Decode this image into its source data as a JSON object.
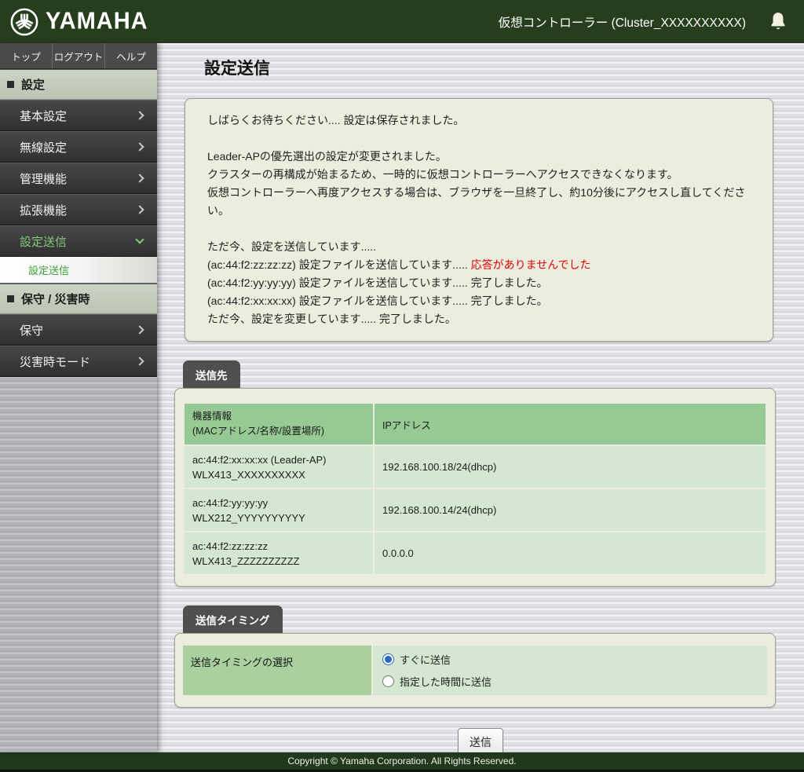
{
  "header": {
    "brand": "YAMAHA",
    "title": "仮想コントローラー (Cluster_XXXXXXXXXX)"
  },
  "nav_tabs": [
    {
      "label": "トップ"
    },
    {
      "label": "ログアウト"
    },
    {
      "label": "ヘルプ"
    }
  ],
  "sidebar": {
    "sections": [
      {
        "heading": "設定",
        "items": [
          {
            "label": "基本設定"
          },
          {
            "label": "無線設定"
          },
          {
            "label": "管理機能"
          },
          {
            "label": "拡張機能"
          },
          {
            "label": "設定送信",
            "expanded": true,
            "children": [
              {
                "label": "設定送信",
                "selected": true
              }
            ]
          }
        ]
      },
      {
        "heading": "保守 / 災害時",
        "items": [
          {
            "label": "保守"
          },
          {
            "label": "災害時モード"
          }
        ]
      }
    ]
  },
  "main": {
    "page_title": "設定送信",
    "message_box": {
      "lines": [
        {
          "text": "しばらくお待ちください.... 設定は保存されました。"
        },
        {
          "text": ""
        },
        {
          "text": "Leader-APの優先選出の設定が変更されました。"
        },
        {
          "text": "クラスターの再構成が始まるため、一時的に仮想コントローラーへアクセスできなくなります。"
        },
        {
          "text": "仮想コントローラーへ再度アクセスする場合は、ブラウザを一旦終了し、約10分後にアクセスし直してください。"
        },
        {
          "text": ""
        },
        {
          "text": "ただ今、設定を送信しています....."
        },
        {
          "text": "(ac:44:f2:zz:zz:zz) 設定ファイルを送信しています..... ",
          "red": "応答がありませんでした"
        },
        {
          "text": "(ac:44:f2:yy:yy:yy) 設定ファイルを送信しています..... 完了しました。"
        },
        {
          "text": "(ac:44:f2:xx:xx:xx) 設定ファイルを送信しています..... 完了しました。"
        },
        {
          "text": "ただ今、設定を変更しています..... 完了しました。"
        }
      ]
    },
    "destination": {
      "tab_label": "送信先",
      "table": {
        "col1_header_lines": [
          "機器情報",
          "(MACアドレス/名称/設置場所)"
        ],
        "col2_header": "IPアドレス",
        "rows": [
          {
            "device_lines": [
              "ac:44:f2:xx:xx:xx (Leader-AP)",
              "WLX413_XXXXXXXXXX"
            ],
            "ip": "192.168.100.18/24(dhcp)"
          },
          {
            "device_lines": [
              "ac:44:f2:yy:yy:yy",
              "WLX212_YYYYYYYYYY"
            ],
            "ip": "192.168.100.14/24(dhcp)"
          },
          {
            "device_lines": [
              "ac:44:f2:zz:zz:zz",
              "WLX413_ZZZZZZZZZZ"
            ],
            "ip": "0.0.0.0"
          }
        ]
      }
    },
    "timing": {
      "tab_label": "送信タイミング",
      "row_label": "送信タイミングの選択",
      "options": [
        {
          "label": "すぐに送信",
          "selected": true
        },
        {
          "label": "指定した時間に送信",
          "selected": false
        }
      ]
    },
    "submit_label": "送信"
  },
  "footer": {
    "copyright": "Copyright © Yamaha Corporation. All Rights Reserved."
  },
  "colors": {
    "header_green": "#273e1e",
    "footer_green": "#20381b",
    "error_red": "#e00000",
    "expanded_item_green": "#84ca7c",
    "subitem_green": "#3da23d",
    "table_header_green": "#96c993",
    "cell_green": "#d5e6d1",
    "label_cell_green": "#a9d09e",
    "radio_blue": "#2a66c8"
  }
}
